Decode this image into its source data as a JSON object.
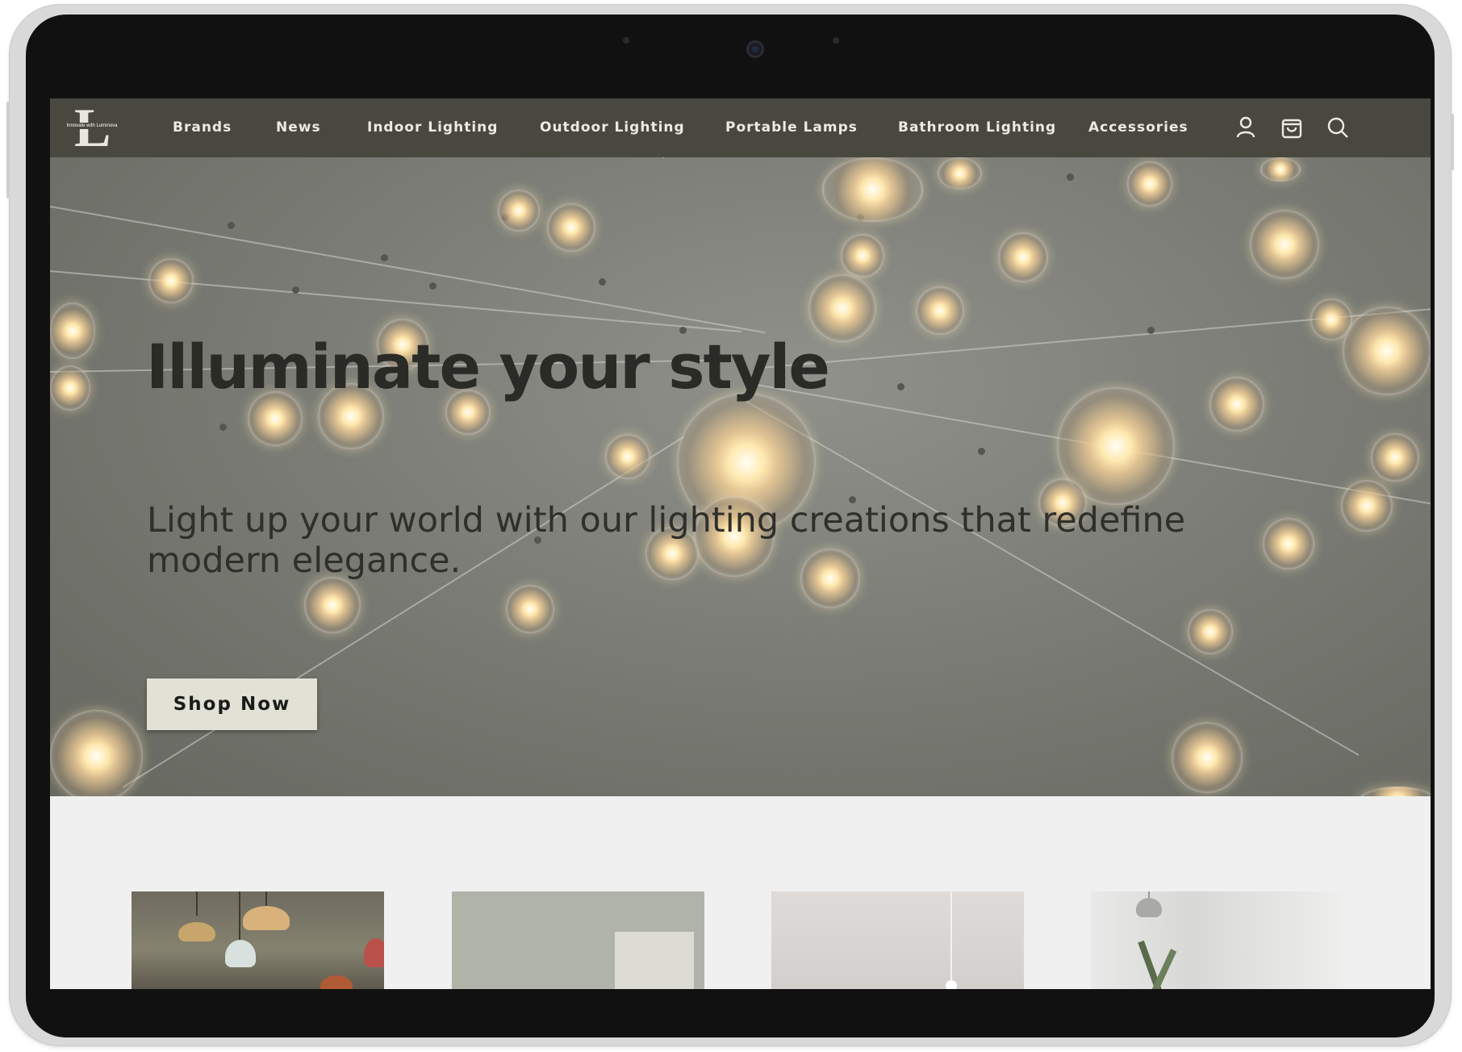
{
  "brand": {
    "logo_letter": "L",
    "tagline": "Innovate with Luminova"
  },
  "nav": {
    "items": [
      {
        "label": "Brands"
      },
      {
        "label": "News"
      },
      {
        "label": "Indoor Lighting"
      },
      {
        "label": "Outdoor Lighting"
      },
      {
        "label": "Portable Lamps"
      },
      {
        "label": "Bathroom Lighting"
      },
      {
        "label": "Accessories"
      }
    ],
    "icons": [
      "user-icon",
      "shopping-bag-icon",
      "search-icon"
    ]
  },
  "hero": {
    "title": "Illuminate your style",
    "subtitle": "Light up your world with our lighting creations that redefine modern elegance.",
    "cta_label": "Shop Now"
  },
  "categories": [
    {
      "image": "pendant-lamps-photo"
    },
    {
      "image": "wall-art-photo"
    },
    {
      "image": "minimal-pendant-photo"
    },
    {
      "image": "arc-floor-lamp-photo"
    }
  ],
  "colors": {
    "navbar": "#48483f",
    "hero_button": "#e2e1d6",
    "page_background": "#f0f0f0",
    "heading_text": "#2a2a26"
  }
}
